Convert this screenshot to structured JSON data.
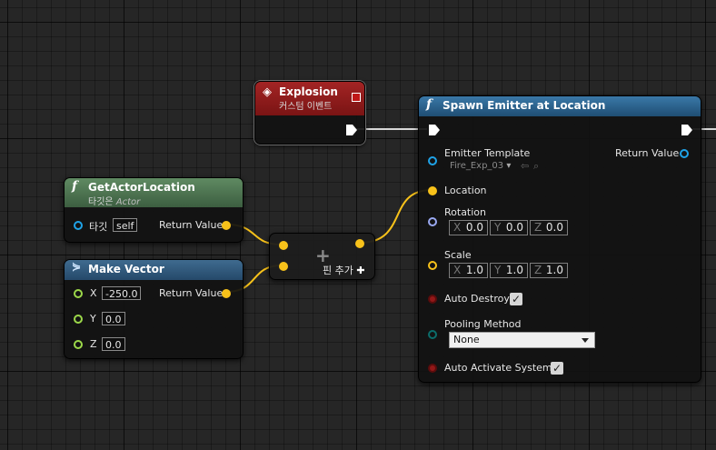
{
  "explosion_node": {
    "title": "Explosion",
    "subtitle": "커스텀 이벤트"
  },
  "get_actor_location": {
    "title": "GetActorLocation",
    "subtitle_prefix": "타깃은",
    "subtitle_target": "Actor",
    "target_label": "타깃",
    "target_value": "self",
    "return_label": "Return Value"
  },
  "make_vector": {
    "title": "Make Vector",
    "x_label": "X",
    "x_value": "-250.0",
    "y_label": "Y",
    "y_value": "0.0",
    "z_label": "Z",
    "z_value": "0.0",
    "return_label": "Return Value"
  },
  "add_node": {
    "symbol": "+",
    "add_pin_label": "핀 추가"
  },
  "spawn_emitter": {
    "title": "Spawn Emitter at Location",
    "emitter_template_label": "Emitter Template",
    "emitter_template_value": "Fire_Exp_03",
    "return_label": "Return Value",
    "location_label": "Location",
    "rotation_label": "Rotation",
    "rotation": {
      "x": "0.0",
      "y": "0.0",
      "z": "0.0"
    },
    "scale_label": "Scale",
    "scale": {
      "x": "1.0",
      "y": "1.0",
      "z": "1.0"
    },
    "axis_x": "X",
    "axis_y": "Y",
    "axis_z": "Z",
    "auto_destroy_label": "Auto Destroy",
    "auto_destroy_checked": true,
    "pooling_method_label": "Pooling Method",
    "pooling_method_value": "None",
    "auto_activate_label": "Auto Activate System",
    "auto_activate_checked": true
  },
  "colors": {
    "event_header": "#8f1b1b",
    "function_header_green": "#4d7550",
    "function_header_blue": "#2c5d82",
    "vector_pin": "#f8c21a",
    "object_pin": "#1fa3e8",
    "float_pin": "#9cd84a",
    "bool_pin": "#921818",
    "rotator_pin": "#9aa9f2",
    "enum_pin": "#0b6d6b"
  },
  "icons": {
    "event": "diamond-event-icon",
    "function": "function-f-icon",
    "struct": "make-struct-icon",
    "browse": "browse-arrow-icon",
    "search": "magnifier-icon"
  }
}
